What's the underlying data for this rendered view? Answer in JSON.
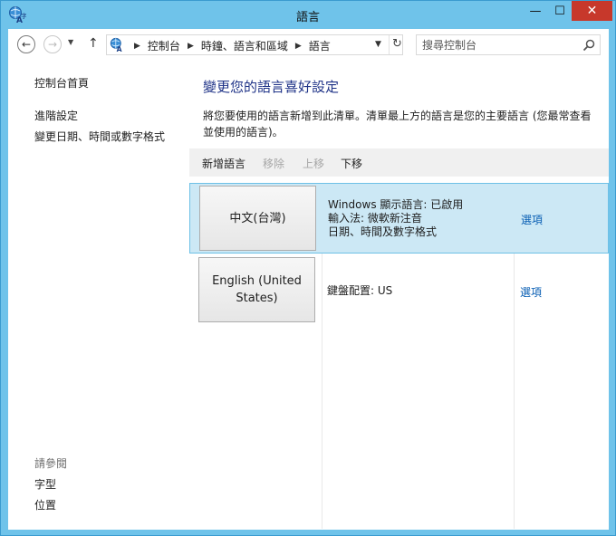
{
  "window": {
    "title": "語言"
  },
  "navigation": {
    "breadcrumbs": [
      "控制台",
      "時鐘、語言和區域",
      "語言"
    ],
    "search_placeholder": "搜尋控制台"
  },
  "sidebar": {
    "home_link": "控制台首頁",
    "links": [
      "進階設定",
      "變更日期、時間或數字格式"
    ],
    "see_also_title": "請參閱",
    "see_also_links": [
      "字型",
      "位置"
    ]
  },
  "main": {
    "title": "變更您的語言喜好設定",
    "description": "將您要使用的語言新增到此清單。清單最上方的語言是您的主要語言 (您最常查看並使用的語言)。",
    "toolbar": {
      "add": "新增語言",
      "remove": "移除",
      "move_up": "上移",
      "move_down": "下移"
    },
    "languages": [
      {
        "name": "中文(台灣)",
        "info": [
          "Windows 顯示語言: 已啟用",
          "輸入法: 微軟新注音",
          "日期、時間及數字格式"
        ],
        "options": "選項",
        "selected": true
      },
      {
        "name": "English (United States)",
        "info": [
          "鍵盤配置: US"
        ],
        "options": "選項",
        "selected": false
      }
    ]
  },
  "colors": {
    "window_frame": "#6fc3ea",
    "close_button": "#c7382b",
    "title_blue": "#1e3287",
    "link_blue": "#0a5fb4",
    "selection": "#cce8f5"
  },
  "icons": [
    "language-icon",
    "back-arrow-icon",
    "forward-arrow-icon",
    "up-arrow-icon",
    "chevron-right-icon",
    "refresh-icon",
    "search-icon"
  ]
}
